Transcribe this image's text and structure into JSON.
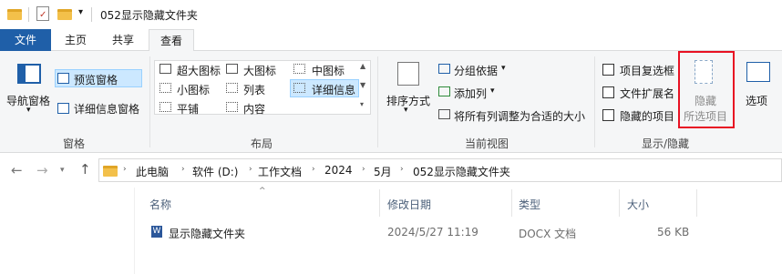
{
  "window": {
    "title": "052显示隐藏文件夹"
  },
  "tabs": {
    "file": "文件",
    "home": "主页",
    "share": "共享",
    "view": "查看"
  },
  "ribbon": {
    "panes": {
      "nav_pane": "导航窗格",
      "preview_pane": "预览窗格",
      "details_pane": "详细信息窗格",
      "group_label": "窗格"
    },
    "layout": {
      "items": [
        "超大图标",
        "大图标",
        "中图标",
        "小图标",
        "列表",
        "详细信息",
        "平铺",
        "内容"
      ],
      "group_label": "布局"
    },
    "current_view": {
      "sort_by": "排序方式",
      "group_by": "分组依据",
      "add_columns": "添加列",
      "size_all_columns": "将所有列调整为合适的大小",
      "group_label": "当前视图"
    },
    "show_hide": {
      "item_checkboxes": "项目复选框",
      "file_extensions": "文件扩展名",
      "hidden_items": "隐藏的项目",
      "hide_selected_line1": "隐藏",
      "hide_selected_line2": "所选项目",
      "options": "选项",
      "group_label": "显示/隐藏"
    }
  },
  "address": {
    "crumbs": [
      "此电脑",
      "软件 (D:)",
      "工作文档",
      "2024",
      "5月",
      "052显示隐藏文件夹"
    ]
  },
  "list": {
    "headers": {
      "name": "名称",
      "modified": "修改日期",
      "type": "类型",
      "size": "大小"
    },
    "rows": [
      {
        "name": "显示隐藏文件夹",
        "modified": "2024/5/27 11:19",
        "type": "DOCX 文档",
        "size": "56 KB"
      }
    ]
  },
  "colors": {
    "file_tab": "#1f5fa8",
    "highlight": "#cce8ff",
    "red_box": "#e81123",
    "folder": "#f3c04a"
  },
  "icons": [
    "folder-icon",
    "checkmark-doc-icon",
    "arrow-back-icon",
    "arrow-forward-icon",
    "arrow-up-icon",
    "word-doc-icon"
  ]
}
